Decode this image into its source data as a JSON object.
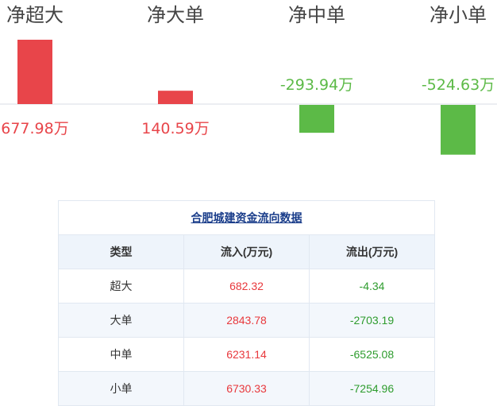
{
  "chart_data": {
    "type": "bar",
    "categories": [
      "净超大",
      "净大单",
      "净中单",
      "净小单"
    ],
    "values": [
      677.98,
      140.59,
      -293.94,
      -524.63
    ],
    "value_labels": [
      "677.98万",
      "140.59万",
      "-293.94万",
      "-524.63万"
    ],
    "colors": {
      "positive": "#e8454a",
      "negative": "#5cba47",
      "axis": "#d8dde6"
    }
  },
  "table": {
    "title": "合肥城建资金流向数据",
    "headers": [
      "类型",
      "流入(万元)",
      "流出(万元)"
    ],
    "rows": [
      [
        "超大",
        "682.32",
        "-4.34"
      ],
      [
        "大单",
        "2843.78",
        "-2703.19"
      ],
      [
        "中单",
        "6231.14",
        "-6525.08"
      ],
      [
        "小单",
        "6730.33",
        "-7254.96"
      ]
    ]
  }
}
